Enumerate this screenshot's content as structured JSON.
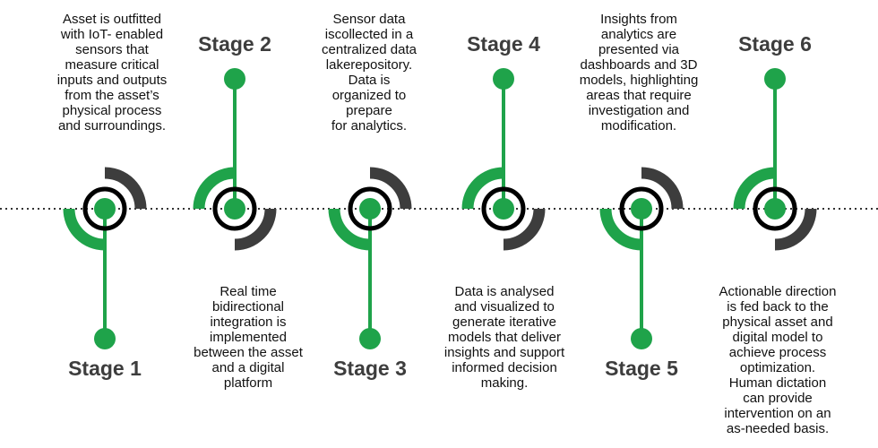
{
  "colors": {
    "green": "#1fa34a",
    "dark": "#3d3d3d",
    "ring": "#000000"
  },
  "stages": [
    {
      "label": "Stage 1",
      "description": [
        "Asset is outfitted",
        "with IoT- enabled",
        "sensors that",
        "measure critical",
        "inputs and outputs",
        "from the asset’s",
        "physical process",
        "and surroundings."
      ]
    },
    {
      "label": "Stage 2",
      "description": [
        "Real time",
        "bidirectional",
        "integration is",
        "implemented",
        "between the asset",
        "and a digital",
        "platform"
      ]
    },
    {
      "label": "Stage 3",
      "description": [
        "Sensor data",
        "iscollected in a",
        "centralized data",
        "lakerepository.",
        "Data is",
        "organized to",
        "prepare",
        "for analytics."
      ]
    },
    {
      "label": "Stage 4",
      "description": [
        "Data is analysed",
        "and visualized to",
        "generate iterative",
        "models that deliver",
        "insights and support",
        "informed decision",
        "making."
      ]
    },
    {
      "label": "Stage 5",
      "description": [
        "Insights from",
        "analytics are",
        "presented via",
        "dashboards and 3D",
        "models, highlighting",
        "areas that require",
        "investigation and",
        "modification."
      ]
    },
    {
      "label": "Stage 6",
      "description": [
        "Actionable direction",
        "is fed back to the",
        "physical asset and",
        "digital model to",
        "achieve process",
        "optimization.",
        "Human dictation",
        "can provide",
        "intervention on an",
        "as-needed basis."
      ]
    }
  ]
}
